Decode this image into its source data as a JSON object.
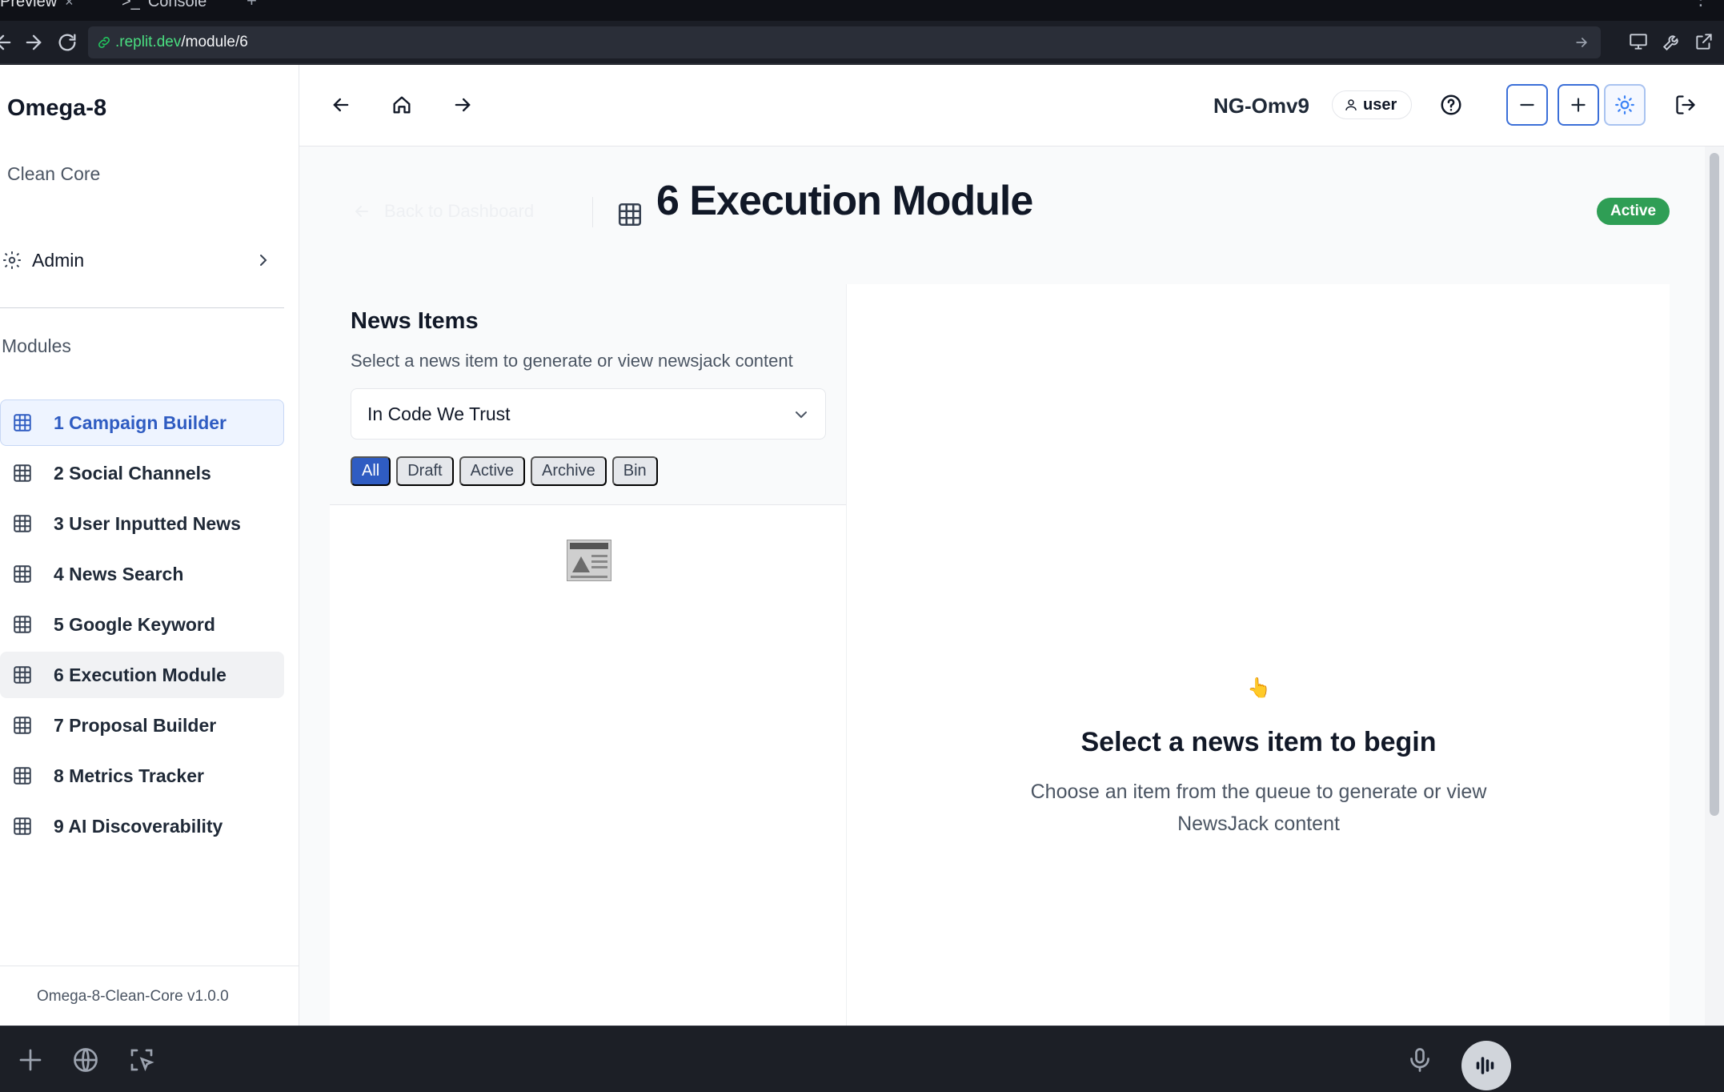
{
  "browser": {
    "tabs": [
      {
        "label": "Preview",
        "close": "×"
      },
      {
        "label": "Console",
        "prefix": ">_"
      }
    ],
    "url_host": ".replit.dev",
    "url_path": "/module/6"
  },
  "sidebar": {
    "brand": "Omega-8",
    "subbrand": "Clean Core",
    "admin_label": "Admin",
    "modules_heading": "Modules",
    "items": [
      {
        "label": "1 Campaign Builder"
      },
      {
        "label": "2 Social Channels"
      },
      {
        "label": "3 User Inputted News"
      },
      {
        "label": "4 News Search"
      },
      {
        "label": "5 Google Keyword"
      },
      {
        "label": "6 Execution Module"
      },
      {
        "label": "7 Proposal Builder"
      },
      {
        "label": "8 Metrics Tracker"
      },
      {
        "label": "9 AI Discoverability"
      }
    ],
    "version": "Omega-8-Clean-Core v1.0.0"
  },
  "header": {
    "account_id": "NG-Omv9",
    "user_label": "user"
  },
  "page": {
    "back_label": "Back to Dashboard",
    "title": "6 Execution Module",
    "status": "Active",
    "status_color": "#2f9e55"
  },
  "news_panel": {
    "title": "News Items",
    "subtitle": "Select a news item to generate or view newsjack content",
    "selected_campaign": "In Code We Trust",
    "filters": [
      "All",
      "Draft",
      "Active",
      "Archive",
      "Bin"
    ],
    "active_filter": "All"
  },
  "empty_state": {
    "icon": "👆",
    "title": "Select a news item to begin",
    "subtitle": "Choose an item from the queue to generate or view NewsJack content"
  },
  "theme": {
    "accent": "#2f5cc2",
    "selected_bg": "#eef4ff"
  }
}
